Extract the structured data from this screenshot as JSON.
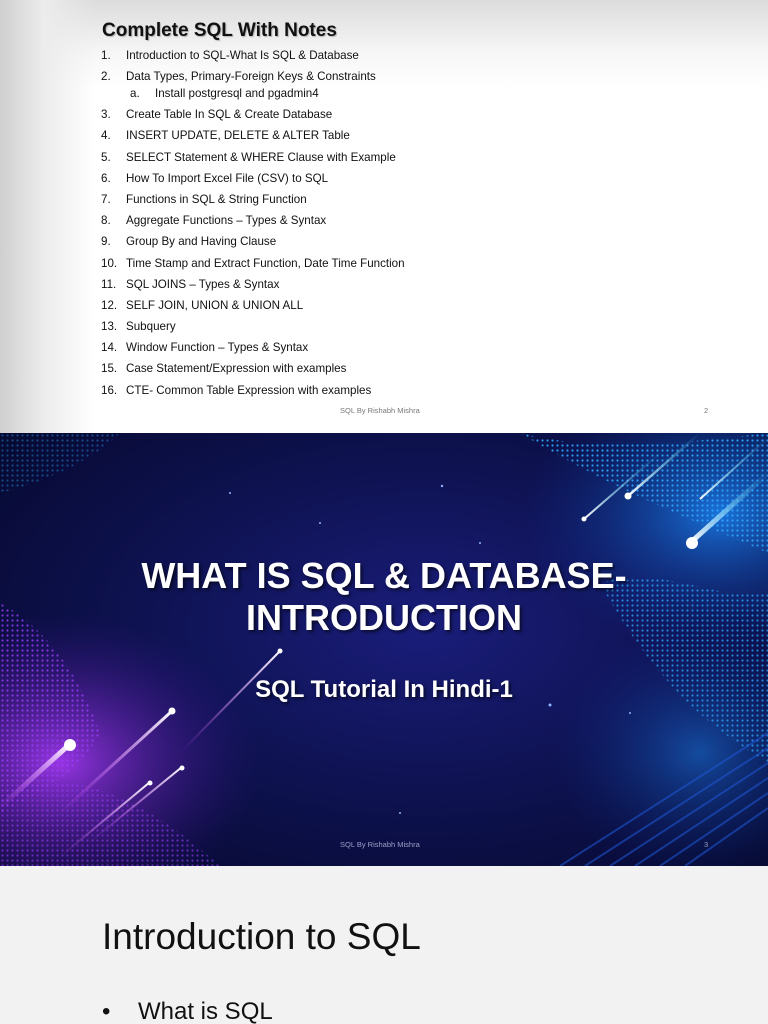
{
  "slide1": {
    "title": "Complete SQL With Notes",
    "items": [
      {
        "num": "1.",
        "text": "Introduction to SQL-What Is SQL & Database"
      },
      {
        "num": "2.",
        "text": "Data Types, Primary-Foreign Keys & Constraints",
        "sub_num": "a.",
        "sub_text": "Install postgresql and pgadmin4"
      },
      {
        "num": "3.",
        "text": "Create Table In SQL & Create Database"
      },
      {
        "num": "4.",
        "text": "INSERT UPDATE, DELETE & ALTER Table"
      },
      {
        "num": "5.",
        "text": "SELECT Statement & WHERE Clause with Example"
      },
      {
        "num": "6.",
        "text": "How To Import Excel File (CSV) to SQL"
      },
      {
        "num": "7.",
        "text": "Functions in SQL & String Function"
      },
      {
        "num": "8.",
        "text": "Aggregate Functions – Types & Syntax"
      },
      {
        "num": "9.",
        "text": "Group By and Having Clause"
      },
      {
        "num": "10.",
        "text": "Time Stamp and Extract Function, Date Time Function"
      },
      {
        "num": "11.",
        "text": "SQL JOINS – Types & Syntax"
      },
      {
        "num": "12.",
        "text": "SELF JOIN, UNION & UNION ALL"
      },
      {
        "num": "13.",
        "text": "Subquery"
      },
      {
        "num": "14.",
        "text": "Window Function – Types & Syntax"
      },
      {
        "num": "15.",
        "text": "Case Statement/Expression with examples"
      },
      {
        "num": "16.",
        "text": "CTE- Common Table Expression with examples"
      }
    ],
    "footer_text": "SQL By Rishabh Mishra",
    "page_number": "2"
  },
  "slide2": {
    "title_line1": "WHAT IS SQL & DATABASE-",
    "title_line2": "INTRODUCTION",
    "subtitle": "SQL Tutorial In Hindi-1",
    "footer_text": "SQL By Rishabh Mishra",
    "page_number": "3"
  },
  "slide3": {
    "title": "Introduction to SQL",
    "bullet_symbol": "•",
    "bullet1": "What is SQL"
  },
  "colors": {
    "slide2_bg": "#0e1250",
    "accent_cyan": "#3fd6ff",
    "accent_magenta": "#d040ff"
  }
}
